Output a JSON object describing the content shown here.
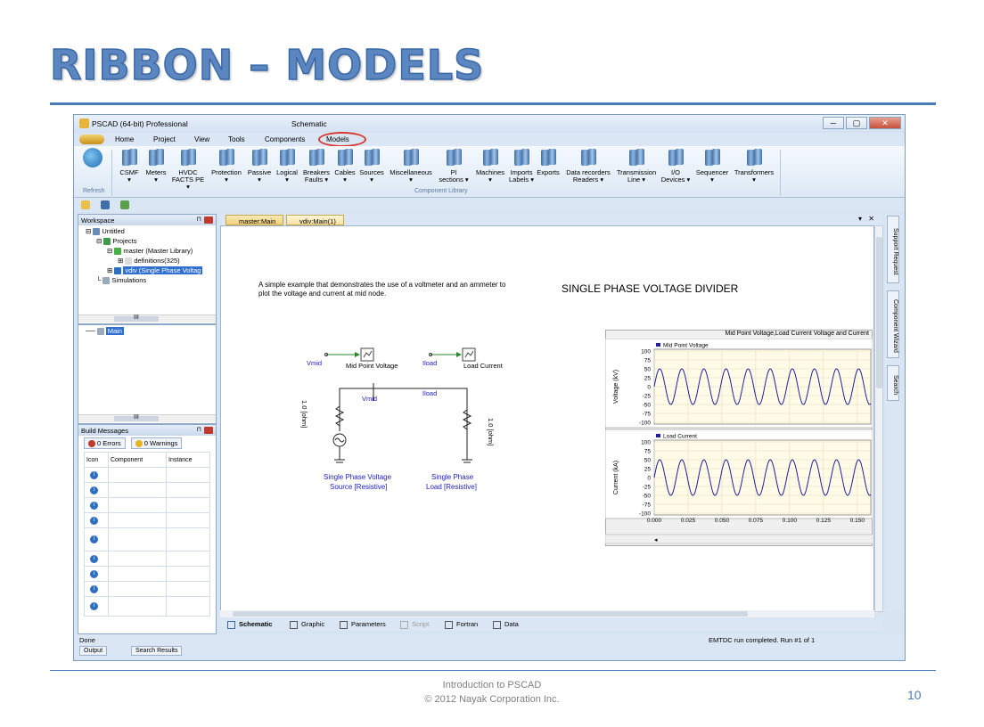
{
  "slide": {
    "title": "RIBBON – MODELS",
    "footer_line1": "Introduction to PSCAD",
    "footer_line2": "© 2012 Nayak Corporation Inc.",
    "page_number": "10"
  },
  "window": {
    "app_title": "PSCAD (64-bit) Professional",
    "doc_title": "Schematic",
    "controls": [
      "─",
      "▢",
      "✕"
    ]
  },
  "menu": {
    "items": [
      "Home",
      "Project",
      "View",
      "Tools",
      "Components",
      "Models"
    ],
    "highlighted": "Models"
  },
  "ribbon": {
    "refresh": "Refresh",
    "buttons": [
      [
        "CSMF",
        "▾"
      ],
      [
        "Meters",
        "▾"
      ],
      [
        "HVDC",
        "FACTS PE ▾"
      ],
      [
        "Protection",
        "▾"
      ],
      [
        "Passive",
        "▾"
      ],
      [
        "Logical",
        "▾"
      ],
      [
        "Breakers",
        "Faults ▾"
      ],
      [
        "Cables",
        "▾"
      ],
      [
        "Sources",
        "▾"
      ],
      [
        "Miscellaneous",
        "▾"
      ],
      [
        "PI",
        "sections ▾"
      ],
      [
        "Machines",
        "▾"
      ],
      [
        "Imports",
        "Labels ▾"
      ],
      [
        "Exports",
        ""
      ],
      [
        "Data recorders",
        "Readers ▾"
      ],
      [
        "Transmission",
        "Line ▾"
      ],
      [
        "I/O",
        "Devices ▾"
      ],
      [
        "Sequencer",
        "▾"
      ],
      [
        "Transformers",
        "▾"
      ]
    ],
    "group_label": "Component Library"
  },
  "workspace": {
    "title": "Workspace",
    "tree": [
      "Untitled",
      "Projects",
      "master (Master Library)",
      "definitions(325)",
      "vdiv (Single Phase Voltag",
      "Simulations"
    ],
    "scroll_marker": "III",
    "lower_item": "Main"
  },
  "build": {
    "title": "Build Messages",
    "errors": "0 Errors",
    "warnings": "0 Warnings",
    "columns": [
      "Icon",
      "Component",
      "Instance"
    ],
    "row_icon": "i",
    "row_count": 9
  },
  "doc_tabs": [
    "master:Main",
    "vdiv:Main(1)"
  ],
  "doc_tab_controls": [
    "▾",
    "✕"
  ],
  "canvas": {
    "description": "A simple example that demonstrates the use of a voltmeter and an ammeter to plot the voltage and current at mid node.",
    "heading": "SINGLE PHASE VOLTAGE DIVIDER",
    "labels": {
      "vmid": "Vmid",
      "midpoint": "Mid Point Voltage",
      "iload": "Iload",
      "loadcurrent": "Load Current",
      "vmid2": "Vmid",
      "iload2": "Iload",
      "r1": "1.0 [ohm]",
      "r2": "1.0 [ohm]",
      "src1": "Single Phase Voltage",
      "src2": "Source [Resistive]",
      "load1": "Single Phase",
      "load2": "Load [Resistive]"
    }
  },
  "graph": {
    "frame_title": "Mid Point Voltage,Load Current Voltage and Current",
    "upper_legend": "Mid Point Voltage",
    "lower_legend": "Load Current",
    "upper_ylabel": "Voltage (kV)",
    "lower_ylabel": "Current (kA)"
  },
  "chart_data": [
    {
      "type": "line",
      "title": "Mid Point Voltage",
      "ylabel": "Voltage (kV)",
      "ylim": [
        -100,
        100
      ],
      "yticks": [
        100,
        75,
        50,
        25,
        0,
        -25,
        -50,
        -75,
        -100
      ],
      "xlim": [
        0,
        0.16
      ],
      "series": [
        {
          "name": "Mid Point Voltage",
          "shape": "sinusoid",
          "amplitude": 50,
          "cycles_visible": 10,
          "color": "#1f1f9f"
        }
      ]
    },
    {
      "type": "line",
      "title": "Load Current",
      "ylabel": "Current (kA)",
      "xlabel": "",
      "ylim": [
        -100,
        100
      ],
      "yticks": [
        100,
        75,
        50,
        25,
        0,
        -25,
        -50,
        -75,
        -100
      ],
      "xticks": [
        "0.000",
        "0.025",
        "0.050",
        "0.075",
        "0.100",
        "0.125",
        "0.150"
      ],
      "xlim": [
        0,
        0.16
      ],
      "series": [
        {
          "name": "Load Current",
          "shape": "sinusoid",
          "amplitude": 50,
          "cycles_visible": 10,
          "color": "#1f1f9f"
        }
      ]
    }
  ],
  "bottom_tabs": [
    "Schematic",
    "Graphic",
    "Parameters",
    "Script",
    "Fortran",
    "Data"
  ],
  "side_tabs": [
    "Support Request",
    "Component Wizard",
    "Search"
  ],
  "status": {
    "left": "Done",
    "right": "EMTDC run completed.  Run #1 of 1"
  },
  "output_tabs": [
    "Output",
    "Search Results"
  ],
  "colors": {
    "accent": "#4a7ab8",
    "highlight_ring": "#d83a2e",
    "trace": "#1f1f9f"
  }
}
